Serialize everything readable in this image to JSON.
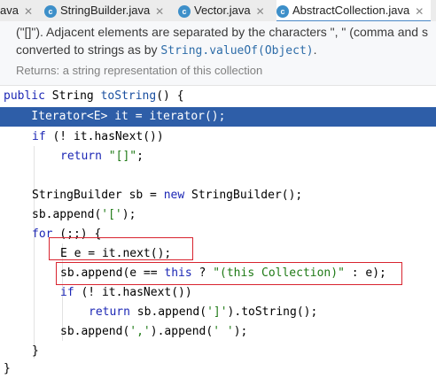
{
  "tabs": [
    {
      "label": "ava"
    },
    {
      "label": "StringBuilder.java",
      "icon": "class-icon"
    },
    {
      "label": "Vector.java",
      "icon": "class-icon"
    },
    {
      "label": "AbstractCollection.java",
      "icon": "class-icon",
      "active": true
    }
  ],
  "doc": {
    "line1_start": "(\"[]\"). Adjacent elements are separated by the characters \", \" (comma and s",
    "line2_start": "converted to strings as by ",
    "line2_code": "String.valueOf(Object)",
    "line2_end": ".",
    "returns": "Returns: a string representation of this collection"
  },
  "code": {
    "l1_kw": "public",
    "l1_type": " String ",
    "l1_fn": "toString",
    "l1_rest": "() {",
    "l2": "    Iterator<E> it = iterator();",
    "l3_kw": "if",
    "l3_rest": " (! it.hasNext())",
    "l4_kw": "return",
    "l4_str": "\"[]\"",
    "l4_end": ";",
    "l6_a": "StringBuilder sb = ",
    "l6_kw": "new",
    "l6_b": " StringBuilder();",
    "l7_a": "sb.append(",
    "l7_str": "'['",
    "l7_b": ");",
    "l8_kw": "for",
    "l8_rest": " (;;) {",
    "l9": "E e = it.next();",
    "l10_a": "sb.append(e == ",
    "l10_kw": "this",
    "l10_b": " ? ",
    "l10_str": "\"(this Collection)\"",
    "l10_c": " : e);",
    "l11_kw": "if",
    "l11_rest": " (! it.hasNext())",
    "l12_kw": "return",
    "l12_a": " sb.append(",
    "l12_str": "']'",
    "l12_b": ").toString();",
    "l13_a": "sb.append(",
    "l13_s1": "','",
    "l13_b": ").append(",
    "l13_s2": "' '",
    "l13_c": ");",
    "l14": "}",
    "l15": "}"
  },
  "colors": {
    "highlight": "#2e5ea8",
    "keyword": "#1c27b5",
    "string": "#1f7a16",
    "annotation_box": "#d8242f"
  }
}
